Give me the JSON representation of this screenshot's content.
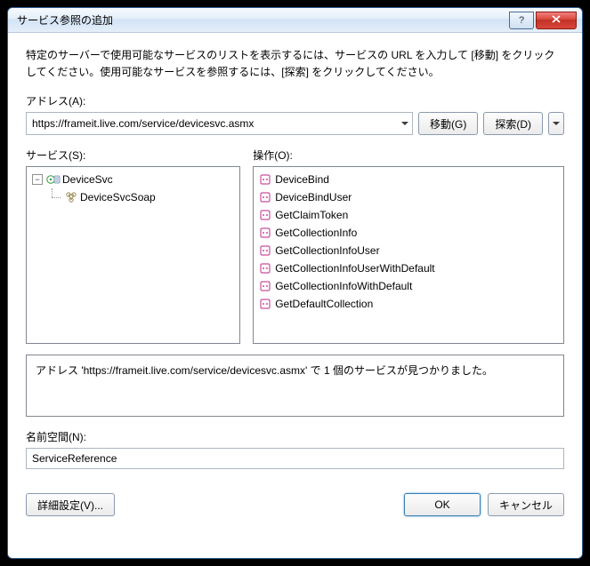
{
  "window": {
    "title": "サービス参照の追加"
  },
  "instructions": "特定のサーバーで使用可能なサービスのリストを表示するには、サービスの URL を入力して [移動] をクリックしてください。使用可能なサービスを参照するには、[探索] をクリックしてください。",
  "address": {
    "label": "アドレス(A):",
    "value": "https://frameit.live.com/service/devicesvc.asmx",
    "go_label": "移動(G)",
    "discover_label": "探索(D)"
  },
  "services": {
    "label": "サービス(S):",
    "root": "DeviceSvc",
    "children": [
      "DeviceSvcSoap"
    ]
  },
  "operations": {
    "label": "操作(O):",
    "items": [
      "DeviceBind",
      "DeviceBindUser",
      "GetClaimToken",
      "GetCollectionInfo",
      "GetCollectionInfoUser",
      "GetCollectionInfoUserWithDefault",
      "GetCollectionInfoWithDefault",
      "GetDefaultCollection"
    ]
  },
  "status": "アドレス 'https://frameit.live.com/service/devicesvc.asmx' で 1 個のサービスが見つかりました。",
  "namespace": {
    "label": "名前空間(N):",
    "value": "ServiceReference"
  },
  "footer": {
    "advanced_label": "詳細設定(V)...",
    "ok_label": "OK",
    "cancel_label": "キャンセル"
  },
  "colors": {
    "op_icon": "#c94f9e",
    "svc_globe": "#2e9e3e"
  }
}
